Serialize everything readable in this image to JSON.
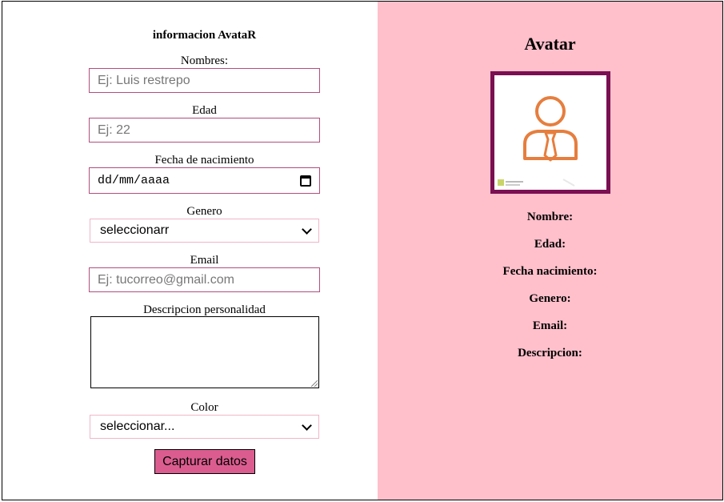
{
  "form": {
    "title": "informacion AvataR",
    "nombres": {
      "label": "Nombres:",
      "placeholder": "Ej: Luis restrepo"
    },
    "edad": {
      "label": "Edad",
      "placeholder": "Ej: 22"
    },
    "fecha": {
      "label": "Fecha de nacimiento",
      "value": "dd/mm/aaaa"
    },
    "genero": {
      "label": "Genero",
      "selected": "seleccionarr"
    },
    "email": {
      "label": "Email",
      "placeholder": "Ej: tucorreo@gmail.com"
    },
    "descripcion": {
      "label": "Descripcion personalidad"
    },
    "color": {
      "label": "Color",
      "selected": "seleccionar..."
    },
    "submit_label": "Capturar datos"
  },
  "avatar": {
    "title": "Avatar",
    "icon": "user-avatar-icon",
    "fields": {
      "nombre": "Nombre:",
      "edad": "Edad:",
      "fecha": "Fecha nacimiento:",
      "genero": "Genero:",
      "email": "Email:",
      "descripcion": "Descripcion:"
    }
  },
  "colors": {
    "panel_bg": "#ffc0cb",
    "input_border": "#b24d7d",
    "button_bg": "#db5d8f",
    "avatar_frame": "#7a0f52",
    "icon_stroke": "#e67e3e"
  }
}
